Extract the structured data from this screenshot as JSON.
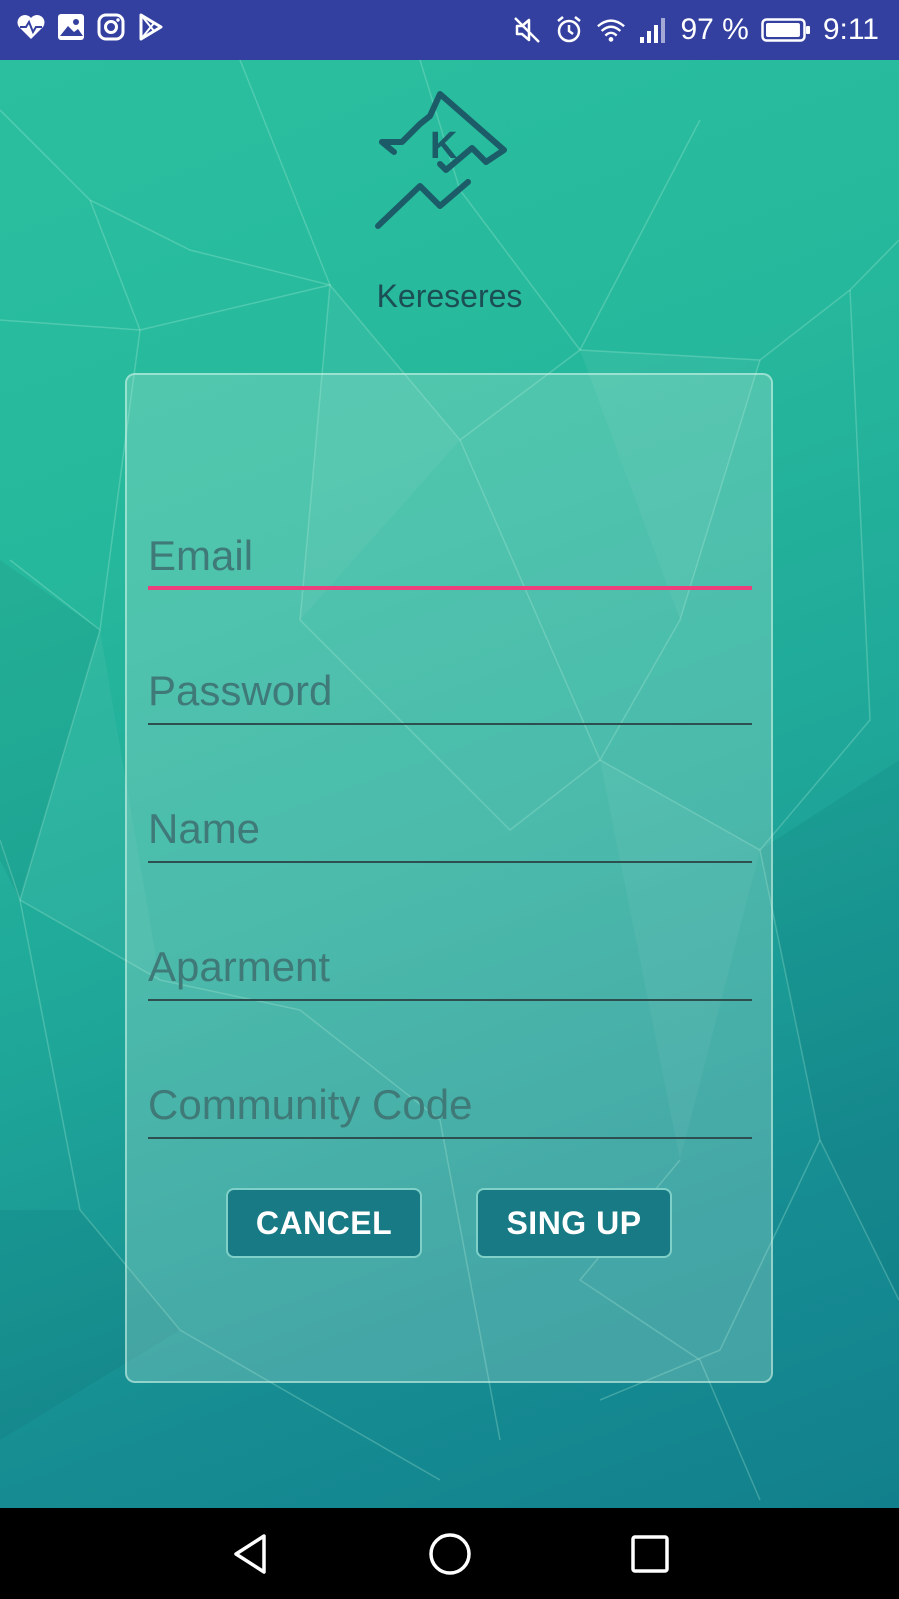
{
  "status_bar": {
    "battery_percent": "97 %",
    "time": "9:11",
    "left_icons": [
      "heart-monitor-icon",
      "photo-icon",
      "instagram-icon",
      "play-store-icon"
    ],
    "right_icons": [
      "mute-icon",
      "alarm-icon",
      "wifi-icon",
      "signal-icon",
      "battery-icon"
    ],
    "battery_level": 0.97
  },
  "app": {
    "name": "Kereseres",
    "logo_icon": "kereseres-logo-icon"
  },
  "form": {
    "fields": [
      {
        "id": "email",
        "placeholder": "Email",
        "focused": true
      },
      {
        "id": "password",
        "placeholder": "Password",
        "focused": false
      },
      {
        "id": "name",
        "placeholder": "Name",
        "focused": false
      },
      {
        "id": "apartment",
        "placeholder": "Aparment",
        "focused": false
      },
      {
        "id": "community_code",
        "placeholder": "Community Code",
        "focused": false
      }
    ],
    "cancel_label": "CANCEL",
    "signup_label": "SING UP"
  },
  "nav_bar": {
    "icons": [
      "back-icon",
      "home-icon",
      "recents-icon"
    ]
  },
  "colors": {
    "status_bar": "#3340a0",
    "accent": "#ee3f7c",
    "button": "#177a85",
    "background_start": "#2bbf9f",
    "background_end": "#12808c"
  }
}
